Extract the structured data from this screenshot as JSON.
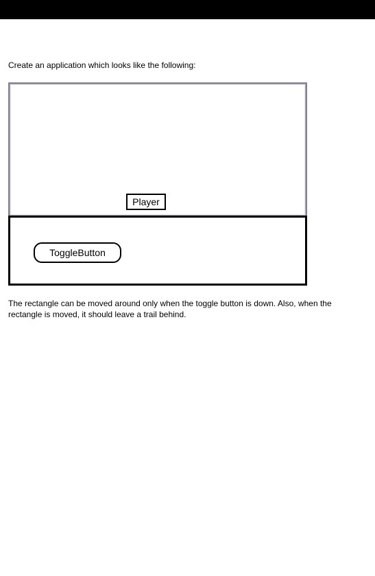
{
  "intro": "Create an application which looks like the following:",
  "mockup": {
    "player_label": "Player",
    "toggle_label": "ToggleButton"
  },
  "description": "The rectangle can be moved around only when the toggle button is down.  Also, when the rectangle is moved, it should leave a trail behind."
}
